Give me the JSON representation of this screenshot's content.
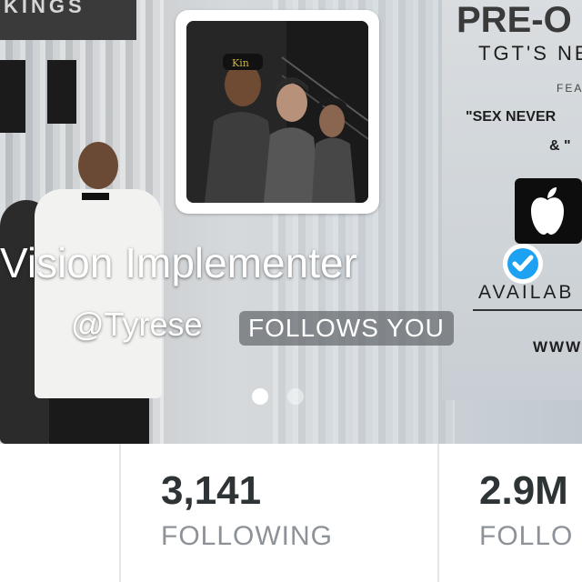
{
  "header": {
    "banner_sign_text": "KINGS",
    "poster_lines": [
      "PRE-O",
      "TGT'S NE",
      "FEA",
      "\"SEX NEVER",
      "& \"",
      "AVAILAB",
      "WWW"
    ],
    "accent_verified": "#1da1f2"
  },
  "profile": {
    "display_name": "Vision Implementer",
    "handle": "@Tyrese",
    "follows_you_label": "FOLLOWS YOU",
    "verified": true,
    "carousel": {
      "pages": 2,
      "active_index": 0
    }
  },
  "stats": [
    {
      "value": "3,141",
      "label": "FOLLOWING"
    },
    {
      "value": "2.9M",
      "label": "FOLLO"
    }
  ]
}
